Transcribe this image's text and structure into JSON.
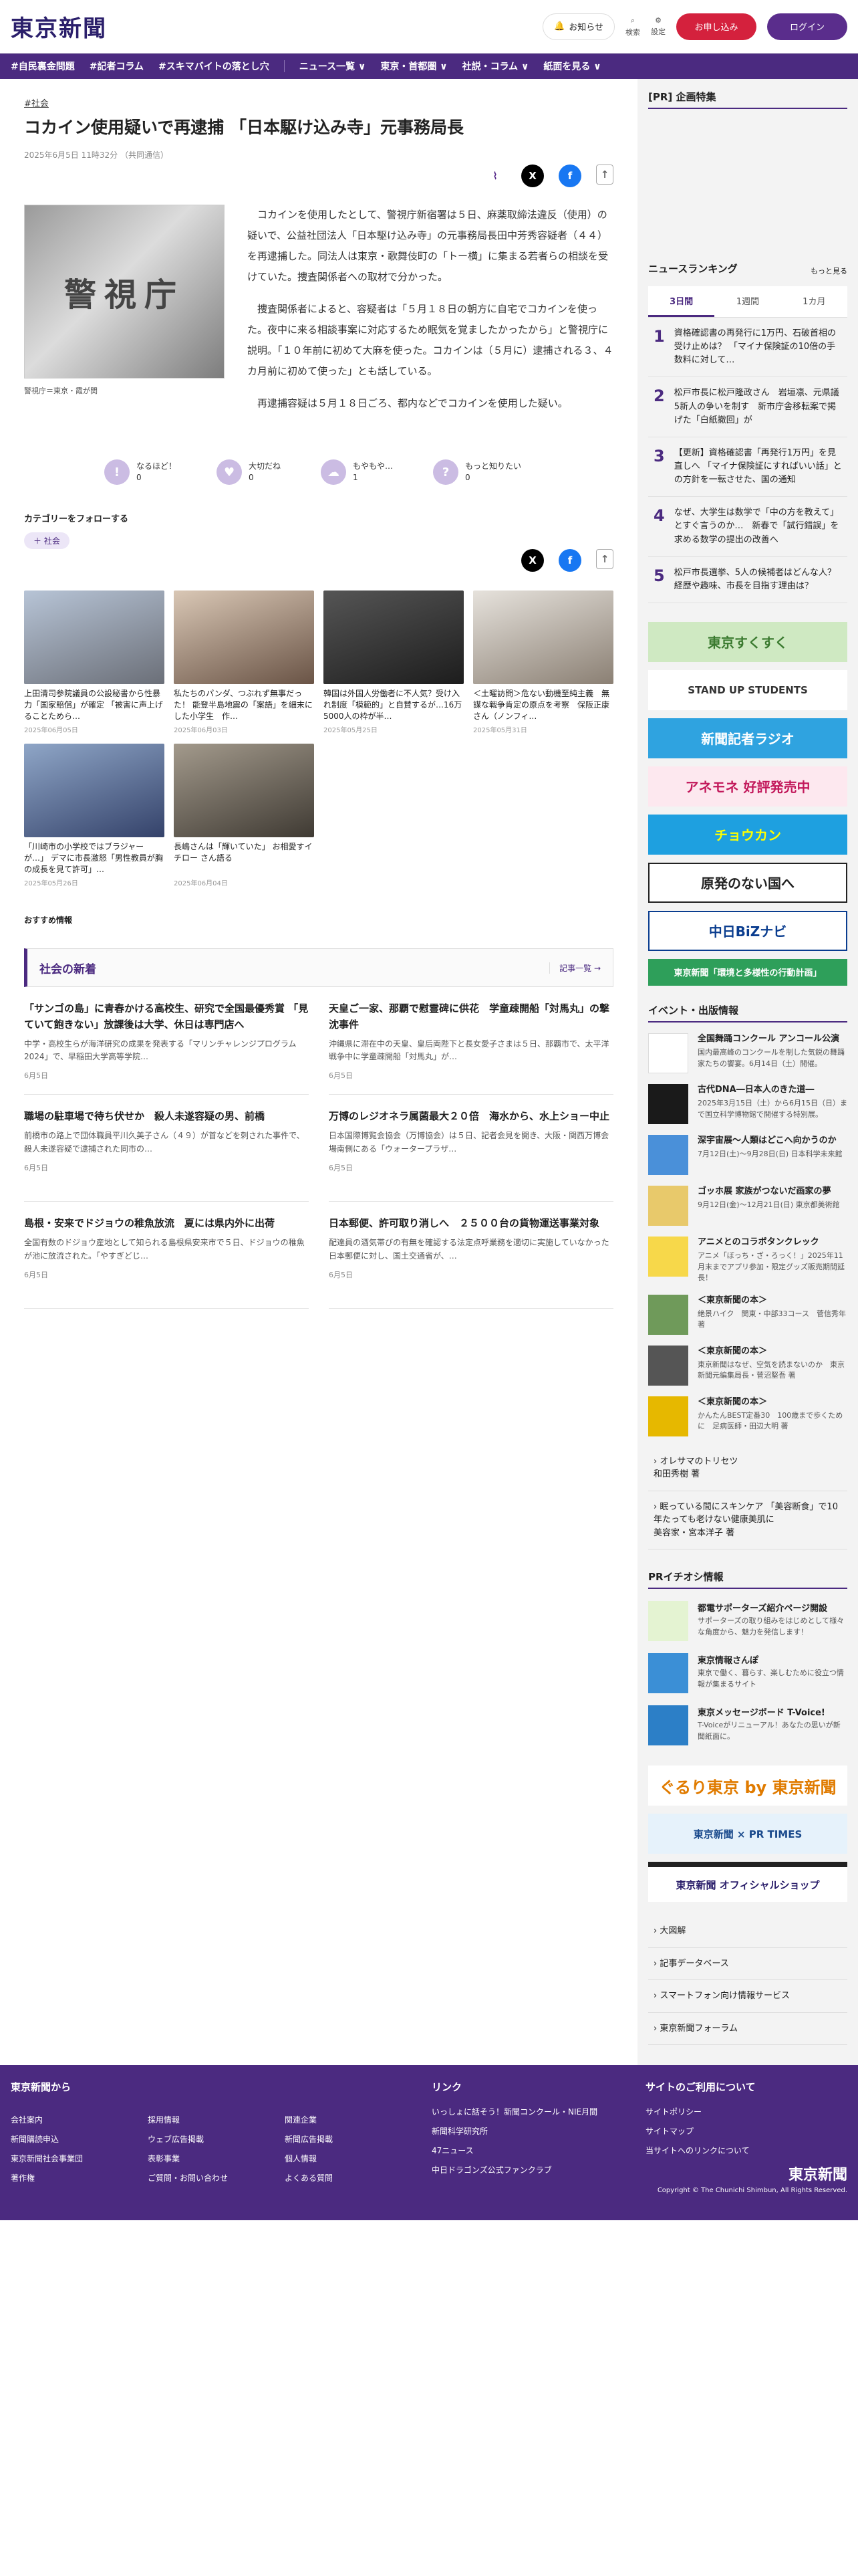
{
  "header": {
    "logo": "東京新聞",
    "notice": "お知らせ",
    "search": "検索",
    "settings": "設定",
    "subscribe": "お申し込み",
    "login": "ログイン"
  },
  "nav": [
    "#自民裏金問題",
    "#記者コラム",
    "#スキマバイトの落とし穴",
    "ニュース一覧 ∨",
    "東京・首都圏 ∨",
    "社説・コラム ∨",
    "紙面を見る ∨"
  ],
  "article": {
    "category": "#社会",
    "title": "コカイン使用疑いで再逮捕 「日本駆け込み寺」元事務局長",
    "date": "2025年6月5日 11時32分 （共同通信）",
    "photo_caption": "警視庁＝東京・霞が関",
    "photo_text": "警視庁",
    "paragraphs": [
      "コカインを使用したとして、警視庁新宿署は５日、麻薬取締法違反（使用）の疑いで、公益社団法人「日本駆け込み寺」の元事務局長田中芳秀容疑者（４４）を再逮捕した。同法人は東京・歌舞伎町の「トー横」に集まる若者らの相談を受けていた。捜査関係者への取材で分かった。",
      "捜査関係者によると、容疑者は「５月１８日の朝方に自宅でコカインを使った。夜中に来る相談事案に対応するため眠気を覚ましたかったから」と警視庁に説明。「１０年前に初めて大麻を使った。コカインは（５月に）逮捕される３、４カ月前に初めて使った」とも話している。",
      "再逮捕容疑は５月１８日ごろ、都内などでコカインを使用した疑い。"
    ]
  },
  "reactions": [
    {
      "label": "なるほど！",
      "count": "0"
    },
    {
      "label": "大切だね",
      "count": "0"
    },
    {
      "label": "もやもや…",
      "count": "1"
    },
    {
      "label": "もっと知りたい",
      "count": "0"
    }
  ],
  "follow": {
    "title": "カテゴリーをフォローする",
    "tag": "社会"
  },
  "related": [
    {
      "title": "上田清司参院議員の公設秘書から性暴力「国家賠償」が確定 「被害に声上げることためら…",
      "date": "2025年06月05日"
    },
    {
      "title": "私たちのパンダ、つぶれず無事だった！ 能登半島地震の「案語」を細末にした小学生　作…",
      "date": "2025年06月03日"
    },
    {
      "title": "韓国は外国人労働者に不人気？受け入れ制度「模範的」と自賛するが…16万5000人の枠が半…",
      "date": "2025年05月25日"
    },
    {
      "title": "＜土曜訪問＞危ない動機至純主義　無謀な戦争肯定の原点を考察　保阪正康さん（ノンフィ…",
      "date": "2025年05月31日"
    },
    {
      "title": "「川崎市の小学校ではブラジャーが…」 デマに市長激怒「男性教員が胸の成長を見て許可」…",
      "date": "2025年05月26日"
    },
    {
      "title": "長嶋さんは「輝いていた」 お相愛すイチロー さん語る",
      "date": "2025年06月04日"
    }
  ],
  "recommend": "おすすめ情報",
  "latest": {
    "title": "社会の新着",
    "more": "記事一覧",
    "items": [
      {
        "title": "「サンゴの島」に青春かける高校生、研究で全国最優秀賞 「見ていて飽きない」放課後は大学、休日は専門店へ",
        "summary": "中学・高校生らが海洋研究の成果を発表する「マリンチャレンジプログラム2024」で、早稲田大学高等学院…",
        "date": "6月5日"
      },
      {
        "title": "天皇ご一家、那覇で慰霊碑に供花　学童疎開船「対馬丸」の撃沈事件",
        "summary": "沖縄県に滞在中の天皇、皇后両陛下と長女愛子さまは５日、那覇市で、太平洋戦争中に学童疎開船「対馬丸」が…",
        "date": "6月5日"
      },
      {
        "title": "職場の駐車場で待ち伏せか　殺人未遂容疑の男、前橋",
        "summary": "前橋市の路上で団体職員平川久美子さん（４９）が首などを刺された事件で、殺人未遂容疑で逮捕された同市の…",
        "date": "6月5日"
      },
      {
        "title": "万博のレジオネラ属菌最大２０倍　海水から、水上ショー中止",
        "summary": "日本国際博覧会協会（万博協会）は５日、記者会見を開き、大阪・関西万博会場南側にある「ウォータープラザ…",
        "date": "6月5日"
      },
      {
        "title": "島根・安来でドジョウの稚魚放流　夏には県内外に出荷",
        "summary": "全国有数のドジョウ産地として知られる島根県安来市で５日、ドジョウの稚魚が池に放流された。「やすぎどじ…",
        "date": "6月5日"
      },
      {
        "title": "日本郵便、許可取り消しへ　２５００台の貨物運送事業対象",
        "summary": "配達員の酒気帯びの有無を確認する法定点呼業務を適切に実施していなかった日本郵便に対し、国土交通省が、…",
        "date": "6月5日"
      }
    ]
  },
  "sidebar": {
    "pr_title": "[PR] 企画特集",
    "ranking_title": "ニュースランキング",
    "ranking_more": "もっと見る",
    "tabs": [
      "3日間",
      "1週間",
      "1カ月"
    ],
    "ranking": [
      "資格確認書の再発行に1万円、石破首相の受け止めは？ 「マイナ保険証の10倍の手数料に対して…",
      "松戸市長に松戸隆政さん　岩垣凛、元県議　5新人の争いを制す　新市庁舎移転案で掲げた「白紙撤回」が",
      "【更新】資格確認書「再発行1万円」を見直しへ 「マイナ保険証にすればいい話」との方針を一転させた、国の通知",
      "なぜ、大学生は数学で「中の方を教えて」とすぐ言うのか…　新春で「試行錯誤」を求める数学の提出の改善へ",
      "松戸市長選挙、5人の候補者はどんな人？ 経歴や趣味、市長を目指す理由は？"
    ],
    "banners": [
      "東京すくすく",
      "STAND UP STUDENTS",
      "新聞記者ラジオ",
      "アネモネ 好評発売中",
      "チョウカン",
      "原発のない国へ",
      "中日BiZナビ",
      "東京新聞「環境と多様性の行動計画」"
    ],
    "events_title": "イベント・出版情報",
    "events": [
      {
        "title": "全国舞踊コンクール アンコール公演",
        "sub": "国内最高峰のコンクールを制した気鋭の舞踊家たちの饗宴。6月14日（土）開催。"
      },
      {
        "title": "古代DNA―日本人のきた道―",
        "sub": "2025年3月15日（土）から6月15日（日）まで国立科学博物館で開催する特別展。"
      },
      {
        "title": "深宇宙展～人類はどこへ向かうのか",
        "sub": "7月12日(土)～9月28日(日) 日本科学未来館"
      },
      {
        "title": "ゴッホ展 家族がつないだ画家の夢",
        "sub": "9月12日(金)～12月21日(日) 東京都美術館"
      },
      {
        "title": "アニメとのコラボタンクレック",
        "sub": "アニメ「ぼっち・ざ・ろっく！」2025年11月末までアプリ参加・限定グッズ販売期間延長！"
      },
      {
        "title": "＜東京新聞の本＞",
        "sub": "絶景ハイク　関東・中部33コース　菅信秀年 著"
      },
      {
        "title": "＜東京新聞の本＞",
        "sub": "東京新聞はなぜ、空気を読まないのか　東京新聞元編集局長・菅沼堅吾 著"
      },
      {
        "title": "＜東京新聞の本＞",
        "sub": "かんたんBEST定番30　100歳まで歩くために　足病医師・田辺大明 著"
      }
    ],
    "books": [
      {
        "title": "オレサマのトリセツ",
        "sub": "和田秀樹 著"
      },
      {
        "title": "眠っている間にスキンケア 「美容断食」で10年たっても老けない健康美肌に",
        "sub": "美容家・宮本洋子 著"
      }
    ],
    "pr_info_title": "PRイチオシ情報",
    "pr_items": [
      {
        "title": "都電サポーターズ紹介ページ開設",
        "sub": "サポーターズの取り組みをはじめとして様々な角度から、魅力を発信します！"
      },
      {
        "title": "東京情報さんぽ",
        "sub": "東京で働く、暮らす、楽しむために役立つ情報が集まるサイト"
      },
      {
        "title": "東京メッセージボード T-Voice!",
        "sub": "T-Voiceがリニューアル！あなたの思いが新聞紙面に。"
      }
    ],
    "ad_banners": [
      "ぐるり東京 by 東京新聞",
      "東京新聞 × PR TIMES",
      "東京新聞 オフィシャルショップ"
    ],
    "links": [
      "大図解",
      "記事データベース",
      "スマートフォン向け情報サービス",
      "東京新聞フォーラム"
    ]
  },
  "footer": {
    "col1_title": "東京新聞から",
    "col1": [
      "会社案内",
      "新聞購読申込",
      "東京新聞社会事業団",
      "著作権"
    ],
    "col2": [
      "採用情報",
      "ウェブ広告掲載",
      "表彰事業",
      "ご質問・お問い合わせ"
    ],
    "col3": [
      "関連企業",
      "新聞広告掲載",
      "個人情報",
      "よくある質問"
    ],
    "col4_title": "リンク",
    "col4": [
      "いっしょに話そう！新聞コンクール・NIE月間",
      "新聞科学研究所",
      "47ニュース",
      "中日ドラゴンズ公式ファンクラブ"
    ],
    "col5_title": "サイトのご利用について",
    "col5": [
      "サイトポリシー",
      "サイトマップ",
      "当サイトへのリンクについて"
    ],
    "logo": "東京新聞",
    "copyright": "Copyright © The Chunichi Shimbun, All Rights Reserved."
  },
  "colors": {
    "brand": "#4b2a80",
    "accent": "#d4213d"
  }
}
